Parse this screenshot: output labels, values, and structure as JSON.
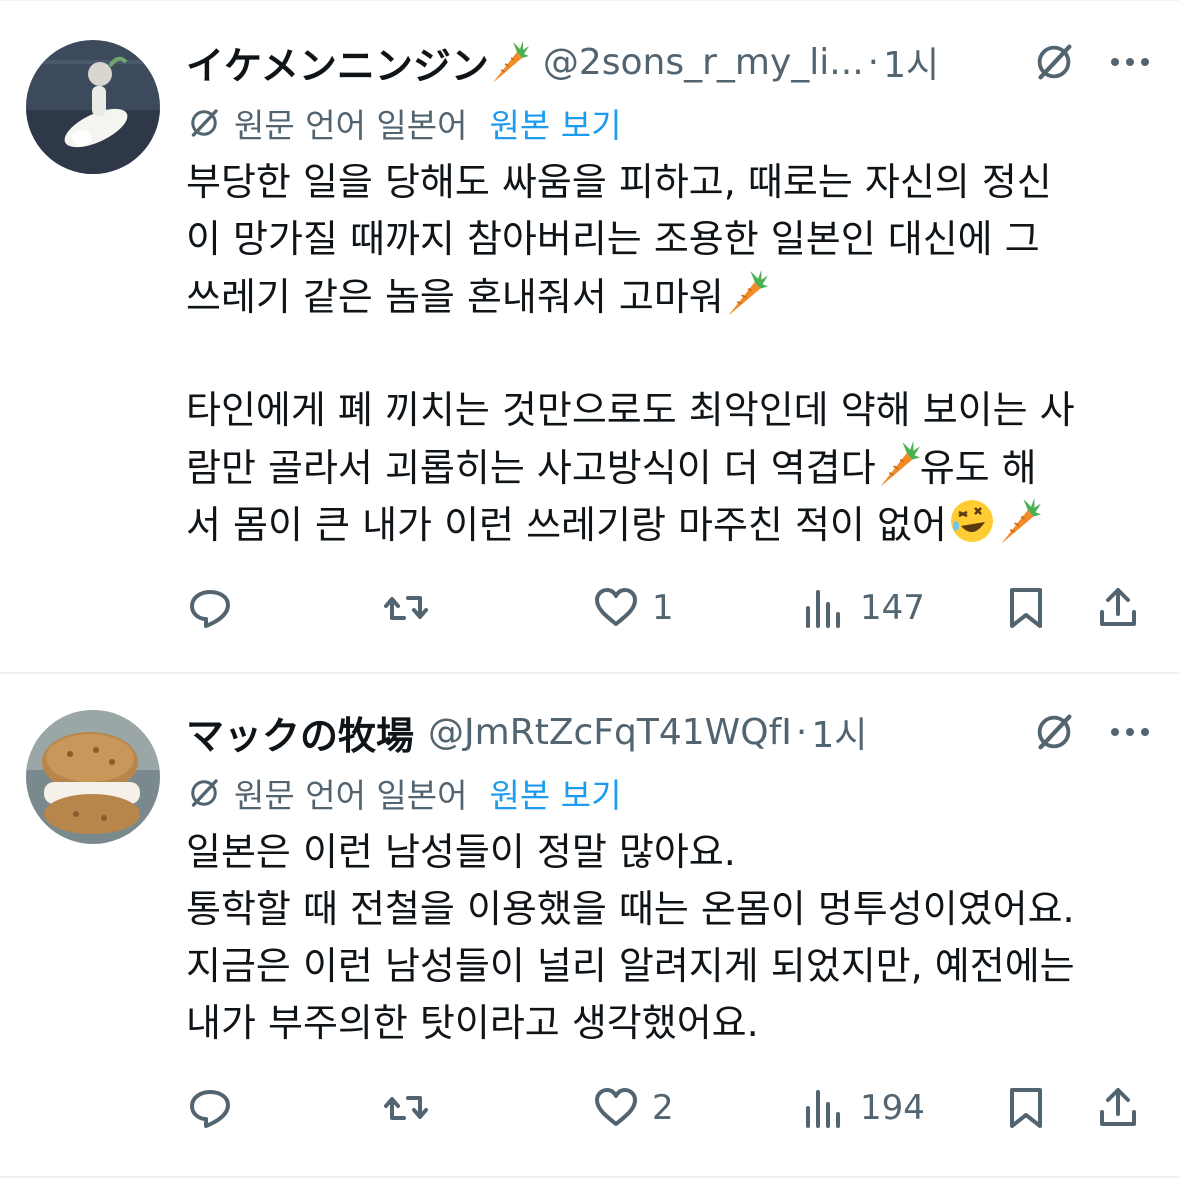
{
  "tweets": [
    {
      "display_name": "イケメンニンジン",
      "handle": "@2sons_r_my_li...",
      "separator": "·",
      "time": "1시",
      "translate_note": "원문 언어 일본어",
      "show_original": "원본 보기",
      "lines": [
        "부당한 일을 당해도 싸움을 피하고, 때로는 자신의 정신",
        "이 망가질 때까지 참아버리는 조용한 일본인 대신에 그",
        "쓰레기 같은 놈을 혼내줘서 고마워",
        "",
        "타인에게 폐 끼치는 것만으로도 최악인데 약해 보이는 사",
        "람만 골라서 괴롭히는 사고방식이 더 역겹다",
        "유도 해",
        "서 몸이 큰 내가 이런 쓰레기랑 마주친 적이 없어"
      ],
      "stats": {
        "replies": "",
        "reposts": "",
        "likes": "1",
        "views": "147"
      }
    },
    {
      "display_name": "マックの牧場",
      "handle": "@JmRtZcFqT41WQfI",
      "separator": "·",
      "time": "1시",
      "translate_note": "원문 언어 일본어",
      "show_original": "원본 보기",
      "lines": [
        "일본은 이런 남성들이 정말 많아요.",
        "통학할 때 전철을 이용했을 때는 온몸이 멍투성이였어요.",
        "지금은 이런 남성들이 널리 알려지게 되었지만, 예전에는",
        "내가 부주의한 탓이라고 생각했어요."
      ],
      "stats": {
        "replies": "",
        "reposts": "",
        "likes": "2",
        "views": "194"
      }
    }
  ],
  "colors": {
    "text": "#0f1419",
    "secondary": "#536471",
    "link": "#1d9bf0",
    "divider": "#eff3f4",
    "carrot": "#f28c28"
  },
  "icons": [
    "grok-icon",
    "more-icon",
    "translate-icon",
    "reply-icon",
    "repost-icon",
    "like-icon",
    "views-icon",
    "bookmark-icon",
    "share-icon",
    "carrot-emoji",
    "laughing-emoji"
  ]
}
